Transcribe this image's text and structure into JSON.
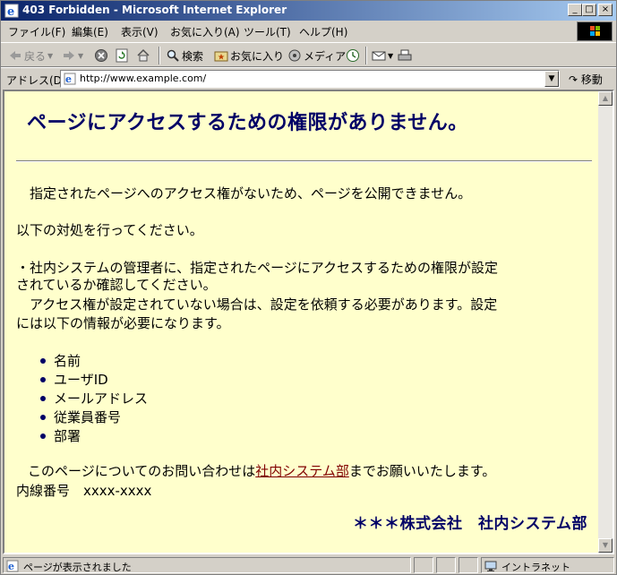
{
  "window": {
    "title": "403 Forbidden - Microsoft Internet Explorer",
    "minimize": "_",
    "maximize": "□",
    "close": "×"
  },
  "menu": {
    "items": [
      "ファイル(F)",
      "編集(E)",
      "表示(V)",
      "お気に入り(A)",
      "ツール(T)",
      "ヘルプ(H)"
    ]
  },
  "toolbar": {
    "back": "戻る",
    "search": "検索",
    "favorites": "お気に入り",
    "media": "メディア"
  },
  "address": {
    "label": "アドレス(D)",
    "url": "http://www.example.com/",
    "go": "移動"
  },
  "page": {
    "heading": "ページにアクセスするための権限がありません。",
    "intro": "指定されたページへのアクセス権がないため、ページを公開できません。",
    "instruction": "以下の対処を行ってください。",
    "step1_line1": "・社内システムの管理者に、指定されたページにアクセスするための権限が設定",
    "step1_line2": "されているか確認してください。",
    "step2_line1": "アクセス権が設定されていない場合は、設定を依頼する必要があります。設定",
    "step2_line2": "には以下の情報が必要になります。",
    "required_info": [
      "名前",
      "ユーザID",
      "メールアドレス",
      "従業員番号",
      "部署"
    ],
    "contact_before": "このページについてのお問い合わせは",
    "contact_link": "社内システム部",
    "contact_after": "までお願いいたします。",
    "extension": "内線番号　xxxx-xxxx",
    "signature": "＊＊＊株式会社　社内システム部"
  },
  "status": {
    "message": "ページが表示されました",
    "zone": "イントラネット"
  },
  "colors": {
    "page_background": "#ffffcc",
    "heading": "#000066",
    "link": "#800000",
    "titlebar_start": "#0a246a"
  }
}
